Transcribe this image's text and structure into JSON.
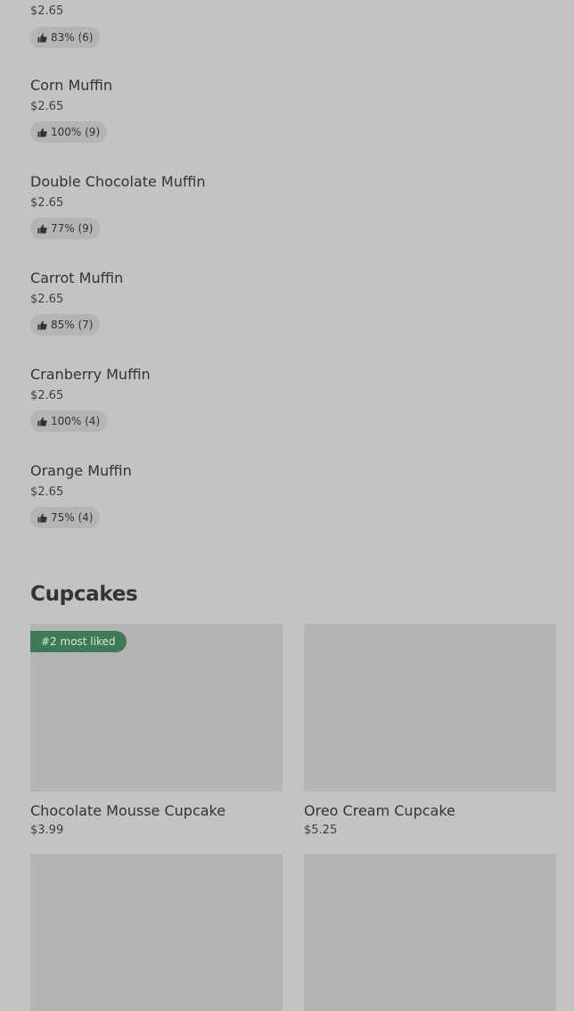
{
  "muffins": {
    "first": {
      "price": "$2.65",
      "rating": "83% (6)"
    },
    "items": [
      {
        "name": "Corn Muffin",
        "price": "$2.65",
        "rating": "100% (9)"
      },
      {
        "name": "Double Chocolate Muffin",
        "price": "$2.65",
        "rating": "77% (9)"
      },
      {
        "name": "Carrot Muffin",
        "price": "$2.65",
        "rating": "85% (7)"
      },
      {
        "name": "Cranberry Muffin",
        "price": "$2.65",
        "rating": "100% (4)"
      },
      {
        "name": "Orange Muffin",
        "price": "$2.65",
        "rating": "75% (4)"
      }
    ]
  },
  "cupcakes": {
    "title": "Cupcakes",
    "cards": [
      {
        "name": "Chocolate Mousse Cupcake",
        "price": "$3.99",
        "badge": "#2 most liked"
      },
      {
        "name": "Oreo Cream Cupcake",
        "price": "$5.25"
      }
    ]
  },
  "icons": {
    "rating": "thumbs-up-icon"
  }
}
